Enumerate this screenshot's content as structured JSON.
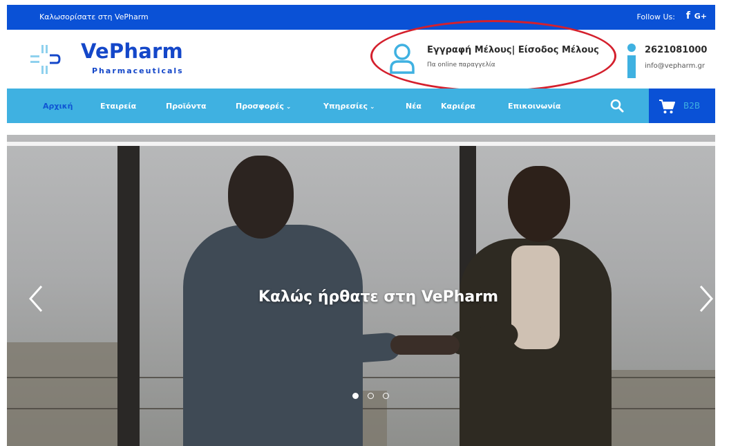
{
  "topbar": {
    "welcome": "Καλωσορίσατε στη VePharm",
    "follow_label": "Follow Us:",
    "facebook_glyph": "f",
    "google_glyph": "G+"
  },
  "header": {
    "logo_name": "VePharm",
    "logo_sub": "Pharmaceuticals",
    "member_title": "Εγγραφή Μέλους| Είσοδος Μέλους",
    "member_sub": "Πα online παραγγελία",
    "phone": "2621081000",
    "email": "info@vepharm.gr"
  },
  "nav": {
    "items": [
      {
        "label": "Αρχική",
        "active": true
      },
      {
        "label": "Εταιρεία"
      },
      {
        "label": "Προϊόντα"
      },
      {
        "label": "Προσφορές",
        "dropdown": true
      },
      {
        "label": "Υπηρεσίες",
        "dropdown": true
      },
      {
        "label": "Νέα"
      },
      {
        "label": "Καριέρα"
      },
      {
        "label": "Επικοινωνία"
      }
    ],
    "cart_label": "B2B"
  },
  "hero": {
    "title": "Καλώς ήρθατε στη VePharm",
    "slide_count": 3,
    "active_slide": 1
  },
  "colors": {
    "brand_blue": "#0a51d6",
    "nav_cyan": "#3fb1e1",
    "highlight_red": "#d4202d"
  }
}
